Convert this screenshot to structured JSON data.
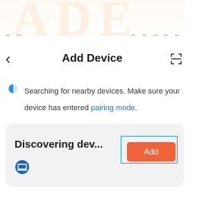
{
  "header": {
    "back_icon": "chevron-left-icon",
    "title": "Add Device",
    "scan_icon": "scan-icon"
  },
  "info": {
    "icon": "half-circle-icon",
    "text_before": "Searching for nearby devices. Make sure your device has entered ",
    "link": "pairing mode",
    "text_after": "."
  },
  "device_card": {
    "name": "Discovering dev...",
    "icon": "device-icon",
    "add_label": "Add"
  },
  "colors": {
    "accent": "#f0623a",
    "link": "#1f6fd4",
    "card_bg": "#f2f2f2",
    "selection_border": "#2a9bd6"
  }
}
